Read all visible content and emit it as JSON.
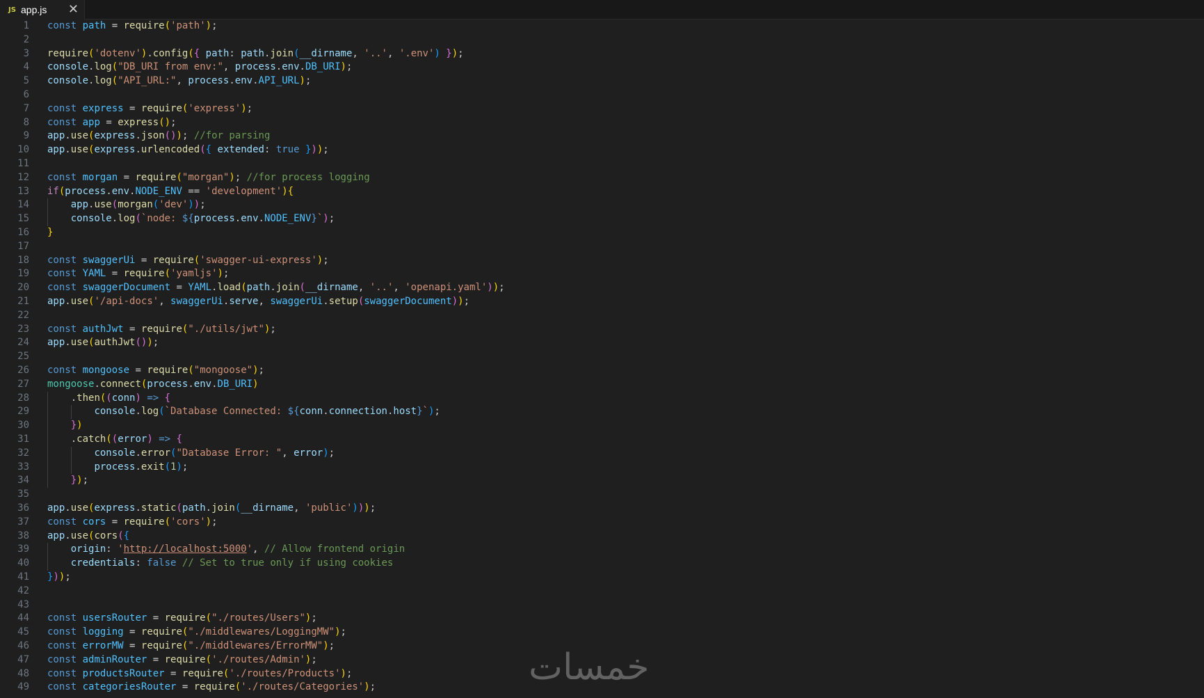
{
  "tab": {
    "icon": "JS",
    "label": "app.js",
    "close_glyph": "✕"
  },
  "watermark": "خمسات",
  "code_lines": [
    [
      [
        "kw",
        "const"
      ],
      [
        "p",
        " "
      ],
      [
        "c",
        "path"
      ],
      [
        "p",
        " = "
      ],
      [
        "f",
        "require"
      ],
      [
        "b1",
        "("
      ],
      [
        "s",
        "'path'"
      ],
      [
        "b1",
        ")"
      ],
      [
        "p",
        ";"
      ]
    ],
    [],
    [
      [
        "f",
        "require"
      ],
      [
        "b1",
        "("
      ],
      [
        "s",
        "'dotenv'"
      ],
      [
        "b1",
        ")"
      ],
      [
        "p",
        "."
      ],
      [
        "f",
        "config"
      ],
      [
        "b1",
        "("
      ],
      [
        "b2",
        "{"
      ],
      [
        "p",
        " "
      ],
      [
        "v",
        "path"
      ],
      [
        "p",
        ": "
      ],
      [
        "v",
        "path"
      ],
      [
        "p",
        "."
      ],
      [
        "f",
        "join"
      ],
      [
        "b3",
        "("
      ],
      [
        "v",
        "__dirname"
      ],
      [
        "p",
        ", "
      ],
      [
        "s",
        "'..'"
      ],
      [
        "p",
        ", "
      ],
      [
        "s",
        "'.env'"
      ],
      [
        "b3",
        ")"
      ],
      [
        "p",
        " "
      ],
      [
        "b2",
        "}"
      ],
      [
        "b1",
        ")"
      ],
      [
        "p",
        ";"
      ]
    ],
    [
      [
        "v",
        "console"
      ],
      [
        "p",
        "."
      ],
      [
        "f",
        "log"
      ],
      [
        "b1",
        "("
      ],
      [
        "s",
        "\"DB_URI from env:\""
      ],
      [
        "p",
        ", "
      ],
      [
        "v",
        "process"
      ],
      [
        "p",
        "."
      ],
      [
        "v",
        "env"
      ],
      [
        "p",
        "."
      ],
      [
        "c",
        "DB_URI"
      ],
      [
        "b1",
        ")"
      ],
      [
        "p",
        ";"
      ]
    ],
    [
      [
        "v",
        "console"
      ],
      [
        "p",
        "."
      ],
      [
        "f",
        "log"
      ],
      [
        "b1",
        "("
      ],
      [
        "s",
        "\"API_URL:\""
      ],
      [
        "p",
        ", "
      ],
      [
        "v",
        "process"
      ],
      [
        "p",
        "."
      ],
      [
        "v",
        "env"
      ],
      [
        "p",
        "."
      ],
      [
        "c",
        "API_URL"
      ],
      [
        "b1",
        ")"
      ],
      [
        "p",
        ";"
      ]
    ],
    [],
    [
      [
        "kw",
        "const"
      ],
      [
        "p",
        " "
      ],
      [
        "c",
        "express"
      ],
      [
        "p",
        " = "
      ],
      [
        "f",
        "require"
      ],
      [
        "b1",
        "("
      ],
      [
        "s",
        "'express'"
      ],
      [
        "b1",
        ")"
      ],
      [
        "p",
        ";"
      ]
    ],
    [
      [
        "kw",
        "const"
      ],
      [
        "p",
        " "
      ],
      [
        "c",
        "app"
      ],
      [
        "p",
        " = "
      ],
      [
        "f",
        "express"
      ],
      [
        "b1",
        "("
      ],
      [
        "b1",
        ")"
      ],
      [
        "p",
        ";"
      ]
    ],
    [
      [
        "v",
        "app"
      ],
      [
        "p",
        "."
      ],
      [
        "f",
        "use"
      ],
      [
        "b1",
        "("
      ],
      [
        "v",
        "express"
      ],
      [
        "p",
        "."
      ],
      [
        "f",
        "json"
      ],
      [
        "b2",
        "("
      ],
      [
        "b2",
        ")"
      ],
      [
        "b1",
        ")"
      ],
      [
        "p",
        "; "
      ],
      [
        "cm",
        "//for parsing"
      ]
    ],
    [
      [
        "v",
        "app"
      ],
      [
        "p",
        "."
      ],
      [
        "f",
        "use"
      ],
      [
        "b1",
        "("
      ],
      [
        "v",
        "express"
      ],
      [
        "p",
        "."
      ],
      [
        "f",
        "urlencoded"
      ],
      [
        "b2",
        "("
      ],
      [
        "b3",
        "{"
      ],
      [
        "p",
        " "
      ],
      [
        "v",
        "extended"
      ],
      [
        "p",
        ": "
      ],
      [
        "kw",
        "true"
      ],
      [
        "p",
        " "
      ],
      [
        "b3",
        "}"
      ],
      [
        "b2",
        ")"
      ],
      [
        "b1",
        ")"
      ],
      [
        "p",
        ";"
      ]
    ],
    [],
    [
      [
        "kw",
        "const"
      ],
      [
        "p",
        " "
      ],
      [
        "c",
        "morgan"
      ],
      [
        "p",
        " = "
      ],
      [
        "f",
        "require"
      ],
      [
        "b1",
        "("
      ],
      [
        "s",
        "\"morgan\""
      ],
      [
        "b1",
        ")"
      ],
      [
        "p",
        "; "
      ],
      [
        "cm",
        "//for process logging"
      ]
    ],
    [
      [
        "ctl",
        "if"
      ],
      [
        "b1",
        "("
      ],
      [
        "v",
        "process"
      ],
      [
        "p",
        "."
      ],
      [
        "v",
        "env"
      ],
      [
        "p",
        "."
      ],
      [
        "c",
        "NODE_ENV"
      ],
      [
        "p",
        " == "
      ],
      [
        "s",
        "'development'"
      ],
      [
        "b1",
        ")"
      ],
      [
        "b1",
        "{"
      ]
    ],
    [
      [
        "p",
        "    "
      ],
      [
        "v",
        "app"
      ],
      [
        "p",
        "."
      ],
      [
        "f",
        "use"
      ],
      [
        "b2",
        "("
      ],
      [
        "f",
        "morgan"
      ],
      [
        "b3",
        "("
      ],
      [
        "s",
        "'dev'"
      ],
      [
        "b3",
        ")"
      ],
      [
        "b2",
        ")"
      ],
      [
        "p",
        ";"
      ]
    ],
    [
      [
        "p",
        "    "
      ],
      [
        "v",
        "console"
      ],
      [
        "p",
        "."
      ],
      [
        "f",
        "log"
      ],
      [
        "b2",
        "("
      ],
      [
        "s",
        "`node: "
      ],
      [
        "kw",
        "${"
      ],
      [
        "v",
        "process"
      ],
      [
        "p",
        "."
      ],
      [
        "v",
        "env"
      ],
      [
        "p",
        "."
      ],
      [
        "c",
        "NODE_ENV"
      ],
      [
        "kw",
        "}"
      ],
      [
        "s",
        "`"
      ],
      [
        "b2",
        ")"
      ],
      [
        "p",
        ";"
      ]
    ],
    [
      [
        "b1",
        "}"
      ]
    ],
    [],
    [
      [
        "kw",
        "const"
      ],
      [
        "p",
        " "
      ],
      [
        "c",
        "swaggerUi"
      ],
      [
        "p",
        " = "
      ],
      [
        "f",
        "require"
      ],
      [
        "b1",
        "("
      ],
      [
        "s",
        "'swagger-ui-express'"
      ],
      [
        "b1",
        ")"
      ],
      [
        "p",
        ";"
      ]
    ],
    [
      [
        "kw",
        "const"
      ],
      [
        "p",
        " "
      ],
      [
        "c",
        "YAML"
      ],
      [
        "p",
        " = "
      ],
      [
        "f",
        "require"
      ],
      [
        "b1",
        "("
      ],
      [
        "s",
        "'yamljs'"
      ],
      [
        "b1",
        ")"
      ],
      [
        "p",
        ";"
      ]
    ],
    [
      [
        "kw",
        "const"
      ],
      [
        "p",
        " "
      ],
      [
        "c",
        "swaggerDocument"
      ],
      [
        "p",
        " = "
      ],
      [
        "c",
        "YAML"
      ],
      [
        "p",
        "."
      ],
      [
        "f",
        "load"
      ],
      [
        "b1",
        "("
      ],
      [
        "v",
        "path"
      ],
      [
        "p",
        "."
      ],
      [
        "f",
        "join"
      ],
      [
        "b2",
        "("
      ],
      [
        "v",
        "__dirname"
      ],
      [
        "p",
        ", "
      ],
      [
        "s",
        "'..'"
      ],
      [
        "p",
        ", "
      ],
      [
        "s",
        "'openapi.yaml'"
      ],
      [
        "b2",
        ")"
      ],
      [
        "b1",
        ")"
      ],
      [
        "p",
        ";"
      ]
    ],
    [
      [
        "v",
        "app"
      ],
      [
        "p",
        "."
      ],
      [
        "f",
        "use"
      ],
      [
        "b1",
        "("
      ],
      [
        "s",
        "'/api-docs'"
      ],
      [
        "p",
        ", "
      ],
      [
        "c",
        "swaggerUi"
      ],
      [
        "p",
        "."
      ],
      [
        "v",
        "serve"
      ],
      [
        "p",
        ", "
      ],
      [
        "c",
        "swaggerUi"
      ],
      [
        "p",
        "."
      ],
      [
        "f",
        "setup"
      ],
      [
        "b2",
        "("
      ],
      [
        "c",
        "swaggerDocument"
      ],
      [
        "b2",
        ")"
      ],
      [
        "b1",
        ")"
      ],
      [
        "p",
        ";"
      ]
    ],
    [],
    [
      [
        "kw",
        "const"
      ],
      [
        "p",
        " "
      ],
      [
        "c",
        "authJwt"
      ],
      [
        "p",
        " = "
      ],
      [
        "f",
        "require"
      ],
      [
        "b1",
        "("
      ],
      [
        "s",
        "\"./utils/jwt\""
      ],
      [
        "b1",
        ")"
      ],
      [
        "p",
        ";"
      ]
    ],
    [
      [
        "v",
        "app"
      ],
      [
        "p",
        "."
      ],
      [
        "f",
        "use"
      ],
      [
        "b1",
        "("
      ],
      [
        "f",
        "authJwt"
      ],
      [
        "b2",
        "("
      ],
      [
        "b2",
        ")"
      ],
      [
        "b1",
        ")"
      ],
      [
        "p",
        ";"
      ]
    ],
    [],
    [
      [
        "kw",
        "const"
      ],
      [
        "p",
        " "
      ],
      [
        "c",
        "mongoose"
      ],
      [
        "p",
        " = "
      ],
      [
        "f",
        "require"
      ],
      [
        "b1",
        "("
      ],
      [
        "s",
        "\"mongoose\""
      ],
      [
        "b1",
        ")"
      ],
      [
        "p",
        ";"
      ]
    ],
    [
      [
        "cls",
        "mongoose"
      ],
      [
        "p",
        "."
      ],
      [
        "f",
        "connect"
      ],
      [
        "b1",
        "("
      ],
      [
        "v",
        "process"
      ],
      [
        "p",
        "."
      ],
      [
        "v",
        "env"
      ],
      [
        "p",
        "."
      ],
      [
        "c",
        "DB_URI"
      ],
      [
        "b1",
        ")"
      ]
    ],
    [
      [
        "p",
        "    ."
      ],
      [
        "f",
        "then"
      ],
      [
        "b1",
        "("
      ],
      [
        "b2",
        "("
      ],
      [
        "v",
        "conn"
      ],
      [
        "b2",
        ")"
      ],
      [
        "p",
        " "
      ],
      [
        "kw",
        "=>"
      ],
      [
        "p",
        " "
      ],
      [
        "b2",
        "{"
      ]
    ],
    [
      [
        "p",
        "        "
      ],
      [
        "v",
        "console"
      ],
      [
        "p",
        "."
      ],
      [
        "f",
        "log"
      ],
      [
        "b3",
        "("
      ],
      [
        "s",
        "`Database Connected: "
      ],
      [
        "kw",
        "${"
      ],
      [
        "v",
        "conn"
      ],
      [
        "p",
        "."
      ],
      [
        "v",
        "connection"
      ],
      [
        "p",
        "."
      ],
      [
        "v",
        "host"
      ],
      [
        "kw",
        "}"
      ],
      [
        "s",
        "`"
      ],
      [
        "b3",
        ")"
      ],
      [
        "p",
        ";"
      ]
    ],
    [
      [
        "p",
        "    "
      ],
      [
        "b2",
        "}"
      ],
      [
        "b1",
        ")"
      ]
    ],
    [
      [
        "p",
        "    ."
      ],
      [
        "f",
        "catch"
      ],
      [
        "b1",
        "("
      ],
      [
        "b2",
        "("
      ],
      [
        "v",
        "error"
      ],
      [
        "b2",
        ")"
      ],
      [
        "p",
        " "
      ],
      [
        "kw",
        "=>"
      ],
      [
        "p",
        " "
      ],
      [
        "b2",
        "{"
      ]
    ],
    [
      [
        "p",
        "        "
      ],
      [
        "v",
        "console"
      ],
      [
        "p",
        "."
      ],
      [
        "f",
        "error"
      ],
      [
        "b3",
        "("
      ],
      [
        "s",
        "\"Database Error: \""
      ],
      [
        "p",
        ", "
      ],
      [
        "v",
        "error"
      ],
      [
        "b3",
        ")"
      ],
      [
        "p",
        ";"
      ]
    ],
    [
      [
        "p",
        "        "
      ],
      [
        "v",
        "process"
      ],
      [
        "p",
        "."
      ],
      [
        "f",
        "exit"
      ],
      [
        "b3",
        "("
      ],
      [
        "n",
        "1"
      ],
      [
        "b3",
        ")"
      ],
      [
        "p",
        ";"
      ]
    ],
    [
      [
        "p",
        "    "
      ],
      [
        "b2",
        "}"
      ],
      [
        "b1",
        ")"
      ],
      [
        "p",
        ";"
      ]
    ],
    [],
    [
      [
        "v",
        "app"
      ],
      [
        "p",
        "."
      ],
      [
        "f",
        "use"
      ],
      [
        "b1",
        "("
      ],
      [
        "v",
        "express"
      ],
      [
        "p",
        "."
      ],
      [
        "f",
        "static"
      ],
      [
        "b2",
        "("
      ],
      [
        "v",
        "path"
      ],
      [
        "p",
        "."
      ],
      [
        "f",
        "join"
      ],
      [
        "b3",
        "("
      ],
      [
        "v",
        "__dirname"
      ],
      [
        "p",
        ", "
      ],
      [
        "s",
        "'public'"
      ],
      [
        "b3",
        ")"
      ],
      [
        "b2",
        ")"
      ],
      [
        "b1",
        ")"
      ],
      [
        "p",
        ";"
      ]
    ],
    [
      [
        "kw",
        "const"
      ],
      [
        "p",
        " "
      ],
      [
        "c",
        "cors"
      ],
      [
        "p",
        " = "
      ],
      [
        "f",
        "require"
      ],
      [
        "b1",
        "("
      ],
      [
        "s",
        "'cors'"
      ],
      [
        "b1",
        ")"
      ],
      [
        "p",
        ";"
      ]
    ],
    [
      [
        "v",
        "app"
      ],
      [
        "p",
        "."
      ],
      [
        "f",
        "use"
      ],
      [
        "b1",
        "("
      ],
      [
        "f",
        "cors"
      ],
      [
        "b2",
        "("
      ],
      [
        "b3",
        "{"
      ]
    ],
    [
      [
        "p",
        "    "
      ],
      [
        "v",
        "origin"
      ],
      [
        "p",
        ": "
      ],
      [
        "s",
        "'"
      ],
      [
        "lnk",
        "http://localhost:5000"
      ],
      [
        "s",
        "'"
      ],
      [
        "p",
        ", "
      ],
      [
        "cm",
        "// Allow frontend origin"
      ]
    ],
    [
      [
        "p",
        "    "
      ],
      [
        "v",
        "credentials"
      ],
      [
        "p",
        ": "
      ],
      [
        "kw",
        "false"
      ],
      [
        "p",
        " "
      ],
      [
        "cm",
        "// Set to true only if using cookies"
      ]
    ],
    [
      [
        "b3",
        "}"
      ],
      [
        "b2",
        ")"
      ],
      [
        "b1",
        ")"
      ],
      [
        "p",
        ";"
      ]
    ],
    [],
    [],
    [
      [
        "kw",
        "const"
      ],
      [
        "p",
        " "
      ],
      [
        "c",
        "usersRouter"
      ],
      [
        "p",
        " = "
      ],
      [
        "f",
        "require"
      ],
      [
        "b1",
        "("
      ],
      [
        "s",
        "\"./routes/Users\""
      ],
      [
        "b1",
        ")"
      ],
      [
        "p",
        ";"
      ]
    ],
    [
      [
        "kw",
        "const"
      ],
      [
        "p",
        " "
      ],
      [
        "c",
        "logging"
      ],
      [
        "p",
        " = "
      ],
      [
        "f",
        "require"
      ],
      [
        "b1",
        "("
      ],
      [
        "s",
        "\"./middlewares/LoggingMW\""
      ],
      [
        "b1",
        ")"
      ],
      [
        "p",
        ";"
      ]
    ],
    [
      [
        "kw",
        "const"
      ],
      [
        "p",
        " "
      ],
      [
        "c",
        "errorMW"
      ],
      [
        "p",
        " = "
      ],
      [
        "f",
        "require"
      ],
      [
        "b1",
        "("
      ],
      [
        "s",
        "\"./middlewares/ErrorMW\""
      ],
      [
        "b1",
        ")"
      ],
      [
        "p",
        ";"
      ]
    ],
    [
      [
        "kw",
        "const"
      ],
      [
        "p",
        " "
      ],
      [
        "c",
        "adminRouter"
      ],
      [
        "p",
        " = "
      ],
      [
        "f",
        "require"
      ],
      [
        "b1",
        "("
      ],
      [
        "s",
        "'./routes/Admin'"
      ],
      [
        "b1",
        ")"
      ],
      [
        "p",
        ";"
      ]
    ],
    [
      [
        "kw",
        "const"
      ],
      [
        "p",
        " "
      ],
      [
        "c",
        "productsRouter"
      ],
      [
        "p",
        " = "
      ],
      [
        "f",
        "require"
      ],
      [
        "b1",
        "("
      ],
      [
        "s",
        "'./routes/Products'"
      ],
      [
        "b1",
        ")"
      ],
      [
        "p",
        ";"
      ]
    ],
    [
      [
        "kw",
        "const"
      ],
      [
        "p",
        " "
      ],
      [
        "c",
        "categoriesRouter"
      ],
      [
        "p",
        " = "
      ],
      [
        "f",
        "require"
      ],
      [
        "b1",
        "("
      ],
      [
        "s",
        "'./routes/Categories'"
      ],
      [
        "b1",
        ")"
      ],
      [
        "p",
        ";"
      ]
    ]
  ]
}
